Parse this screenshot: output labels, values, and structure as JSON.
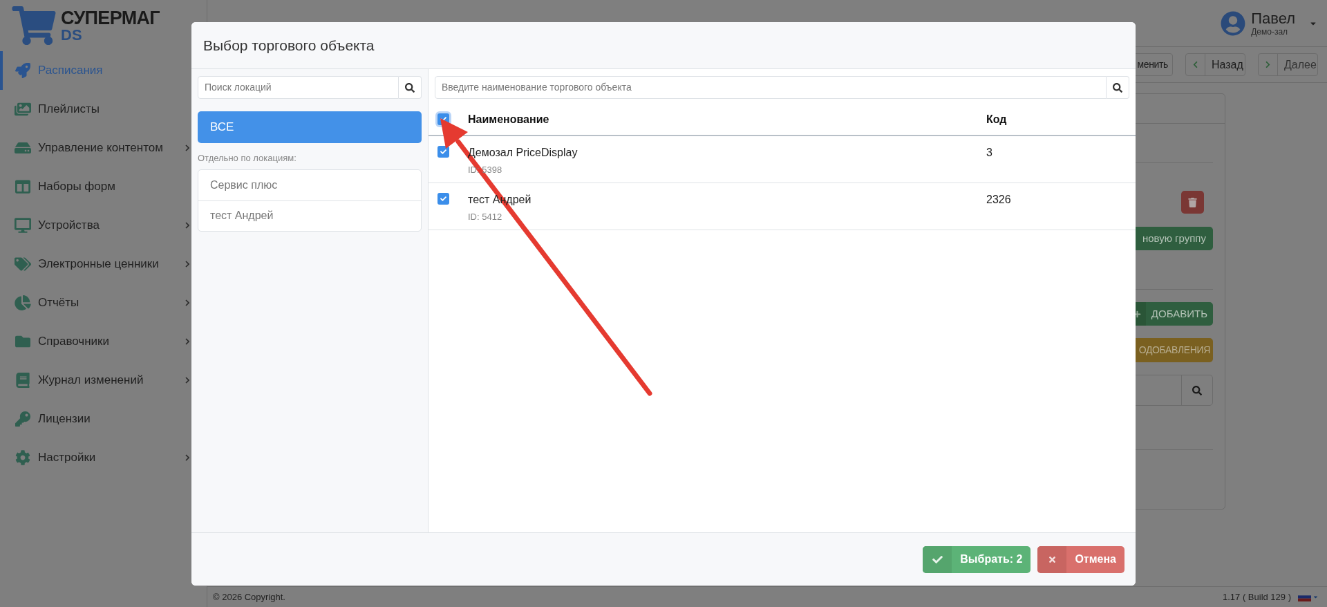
{
  "logo": {
    "brand": "СУПЕРМАГ",
    "suffix": "DS"
  },
  "sidebar": {
    "items": [
      {
        "label": "Расписания",
        "selected": true,
        "expandable": false
      },
      {
        "label": "Плейлисты",
        "selected": false,
        "expandable": false
      },
      {
        "label": "Управление контентом",
        "selected": false,
        "expandable": true
      },
      {
        "label": "Наборы форм",
        "selected": false,
        "expandable": false
      },
      {
        "label": "Устройства",
        "selected": false,
        "expandable": true
      },
      {
        "label": "Электронные ценники",
        "selected": false,
        "expandable": true
      },
      {
        "label": "Отчёты",
        "selected": false,
        "expandable": true
      },
      {
        "label": "Справочники",
        "selected": false,
        "expandable": true
      },
      {
        "label": "Журнал изменений",
        "selected": false,
        "expandable": true
      },
      {
        "label": "Лицензии",
        "selected": false,
        "expandable": false
      },
      {
        "label": "Настройки",
        "selected": false,
        "expandable": true
      }
    ]
  },
  "page": {
    "user": {
      "name": "Павел",
      "role": "Демо-зал"
    },
    "toolbar": [
      {
        "kind": "plain",
        "label": "менить"
      },
      {
        "kind": "back",
        "label": "Назад"
      },
      {
        "kind": "next",
        "label": "Далее"
      }
    ],
    "card": {
      "new_group_button": "новую группу",
      "add_button": "ДОБАВИТЬ",
      "bulk_button": "ОДОБАВЛЕНИЯ"
    }
  },
  "footer": {
    "copyright": "© 2026 Copyright.",
    "version": "1.17 ( Build 129 )"
  },
  "dialog": {
    "title": "Выбор торгового объекта",
    "location_search": {
      "placeholder": "Поиск локаций"
    },
    "all_button": {
      "label": "ВСЕ",
      "selected": true
    },
    "locations_label": "Отдельно по локациям:",
    "locations": [
      {
        "label": "Сервис плюс",
        "selected": false
      },
      {
        "label": "тест Андрей",
        "selected": false
      }
    ],
    "object_search": {
      "placeholder": "Введите наименование торгового объекта"
    },
    "table": {
      "columns": [
        "Наименование",
        "Код"
      ],
      "all_checked": true,
      "rows": [
        {
          "name": "Демозал PriceDisplay",
          "id": "ID: 5398",
          "code": "3",
          "checked": true
        },
        {
          "name": "тест Андрей",
          "id": "ID: 5412",
          "code": "2326",
          "checked": true
        }
      ]
    },
    "buttons": [
      {
        "kind": "confirm",
        "label": "Выбрать: 2"
      },
      {
        "kind": "cancel",
        "label": "Отмена"
      }
    ]
  }
}
